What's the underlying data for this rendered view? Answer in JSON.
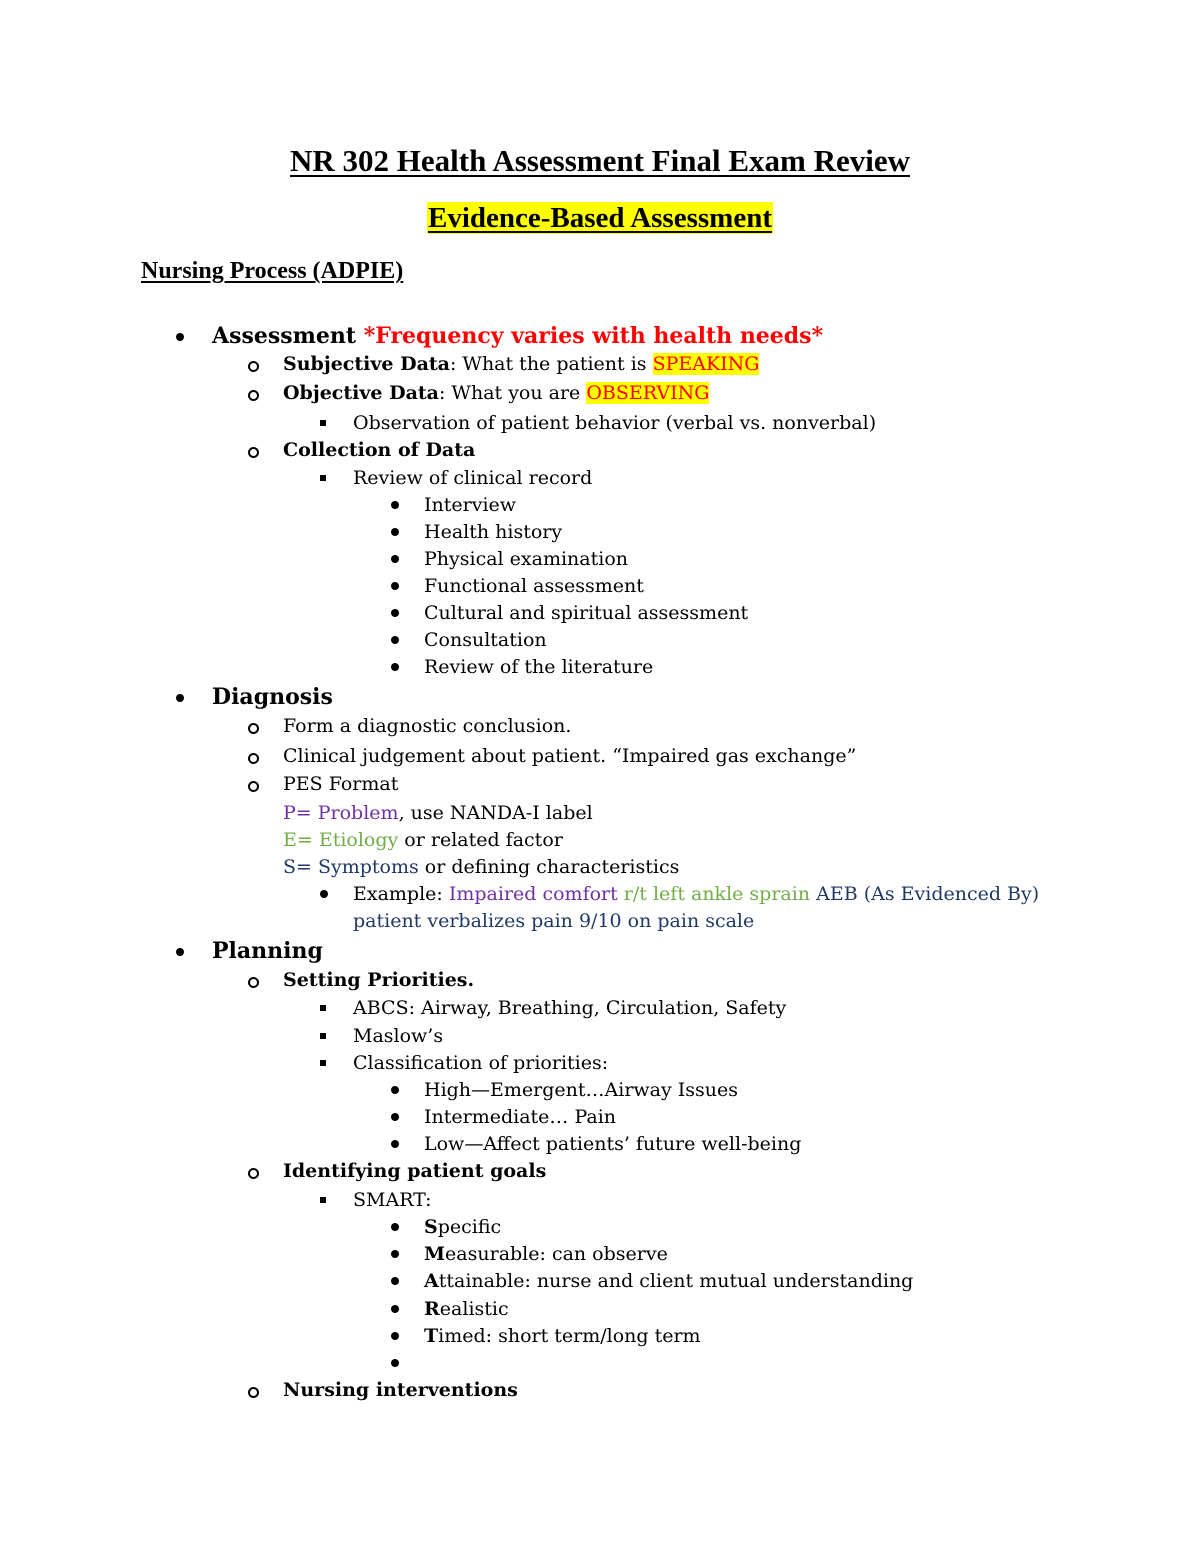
{
  "document": {
    "title": "NR 302 Health Assessment Final Exam Review",
    "section_title": "Evidence-Based Assessment",
    "subsection_title": "Nursing Process (ADPIE)",
    "colors": {
      "highlight": "#ffff00",
      "emphasis_red": "#ff0000",
      "problem_purple": "#7030a0",
      "etiology_green": "#70ad47",
      "symptoms_navy": "#1f3864"
    }
  },
  "assessment": {
    "label": "Assessment",
    "note": "*Frequency varies with health needs*",
    "subjective_label": "Subjective Data",
    "subjective_text": ": What the patient is ",
    "subjective_highlight": "SPEAKING",
    "objective_label": "Objective Data",
    "objective_text": ": What you are ",
    "objective_highlight": "OBSERVING",
    "observation": "Observation of patient behavior (verbal vs. nonverbal)",
    "collection_label": "Collection of Data",
    "review_record": "Review of clinical record",
    "record_items": [
      "Interview",
      "Health history",
      "Physical examination",
      "Functional assessment",
      "Cultural and spiritual assessment",
      "Consultation",
      "Review of the literature"
    ]
  },
  "diagnosis": {
    "label": "Diagnosis",
    "items": [
      "Form a diagnostic conclusion.",
      "Clinical judgement about patient. “Impaired gas exchange”",
      "PES Format"
    ],
    "p_colored": "P= Problem",
    "p_rest": ", use NANDA-I label",
    "e_colored": "E= Etiology",
    "e_rest": " or related factor",
    "s_colored": "S= Symptoms",
    "s_rest": " or defining characteristics",
    "example_label": "Example: ",
    "example_problem": "Impaired comfort",
    "example_etiology": " r/t left ankle sprain",
    "example_aeb": " AEB (As Evidenced By)",
    "example_symptoms": "patient verbalizes pain 9/10 on pain scale"
  },
  "planning": {
    "label": "Planning",
    "priorities_label": "Setting Priorities.",
    "priority_items": [
      "ABCS: Airway, Breathing, Circulation, Safety",
      "Maslow’s",
      "Classification of priorities:"
    ],
    "classification": [
      "High—Emergent…Airway Issues",
      "Intermediate… Pain",
      "Low—Affect patients’ future well-being"
    ],
    "goals_label": "Identifying patient goals",
    "smart_label": "SMART:",
    "smart": [
      {
        "letter": "S",
        "rest": "pecific"
      },
      {
        "letter": "M",
        "rest": "easurable: can observe"
      },
      {
        "letter": "A",
        "rest": "ttainable: nurse and client mutual understanding"
      },
      {
        "letter": "R",
        "rest": "ealistic"
      },
      {
        "letter": "T",
        "rest": "imed: short term/long term"
      },
      {
        "letter": "",
        "rest": ""
      }
    ],
    "interventions_label": "Nursing interventions"
  }
}
